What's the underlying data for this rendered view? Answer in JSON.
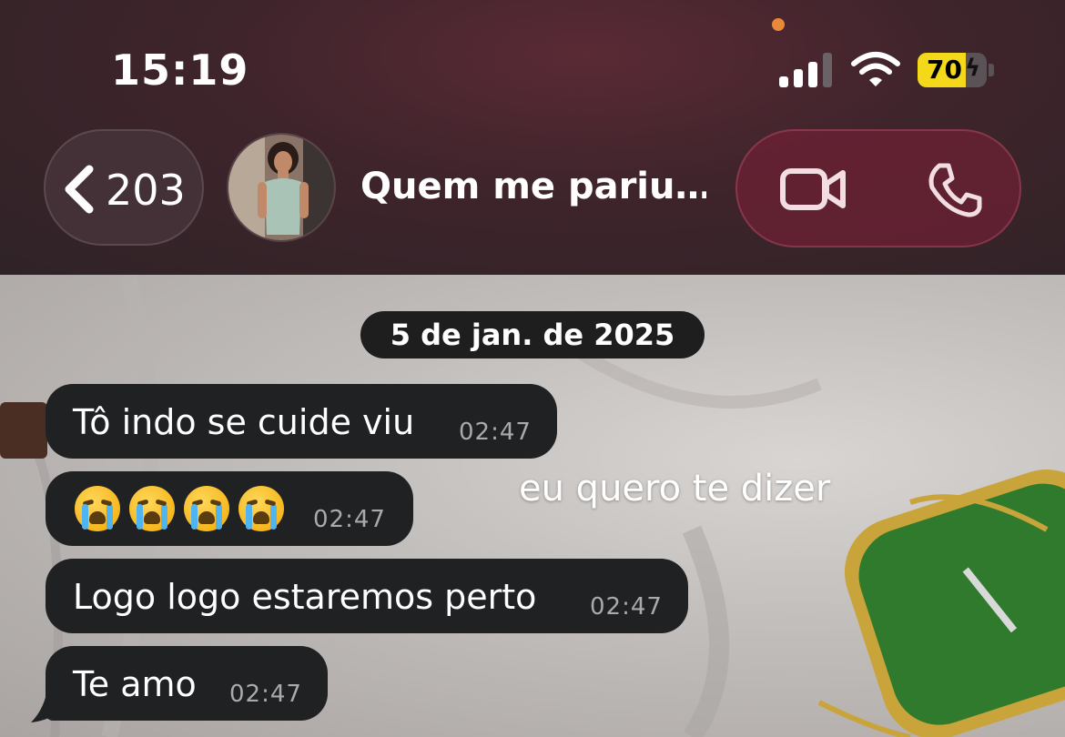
{
  "status_bar": {
    "time": "15:19",
    "battery_percent": "70",
    "battery_level": 0.7,
    "signal_bars_active": 3,
    "charging": true,
    "colors": {
      "battery_fill": "#f4d81a",
      "privacy_dot": "#e8893a"
    }
  },
  "header": {
    "back_count": "203",
    "contact_name": "Quem me pariu…",
    "icons": {
      "back": "chevron-left-icon",
      "video": "video-camera-icon",
      "call": "phone-icon"
    },
    "colors": {
      "call_pill": "#6e2034"
    }
  },
  "chat": {
    "date_separator": "5 de jan. de 2025",
    "messages": [
      {
        "text": "Tô indo se cuide viu",
        "time": "02:47"
      },
      {
        "text": "",
        "emoji": [
          "loudly-crying-face",
          "loudly-crying-face",
          "loudly-crying-face",
          "loudly-crying-face"
        ],
        "time": "02:47"
      },
      {
        "text": "Logo logo estaremos perto",
        "time": "02:47"
      },
      {
        "text": "Te amo",
        "time": "02:47"
      }
    ],
    "overlay_caption": "eu quero te dizer",
    "colors": {
      "bubble": "#1f2122",
      "time_text": "#a8abad"
    }
  }
}
